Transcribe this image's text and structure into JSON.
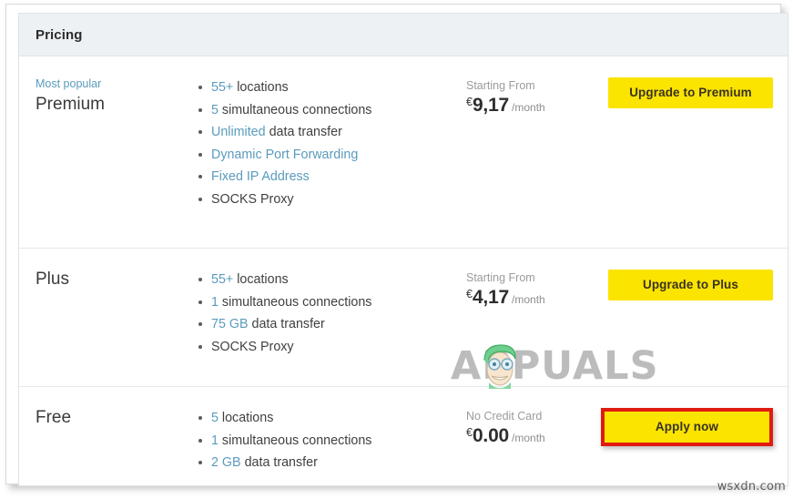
{
  "panel": {
    "title": "Pricing"
  },
  "plans": [
    {
      "badge": "Most popular",
      "name": "Premium",
      "features": [
        {
          "highlight": "55+",
          "rest": " locations"
        },
        {
          "highlight": "5",
          "rest": " simultaneous connections"
        },
        {
          "highlight": "Unlimited",
          "rest": " data transfer"
        },
        {
          "highlight": "Dynamic Port Forwarding",
          "rest": ""
        },
        {
          "highlight": "Fixed IP Address",
          "rest": ""
        },
        {
          "highlight": "",
          "rest": "SOCKS Proxy"
        }
      ],
      "price_label": "Starting From",
      "currency": "€",
      "amount": "9,17",
      "period": "/month",
      "cta": "Upgrade to Premium",
      "cta_highlighted": false
    },
    {
      "badge": "",
      "name": "Plus",
      "features": [
        {
          "highlight": "55+",
          "rest": " locations"
        },
        {
          "highlight": "1",
          "rest": " simultaneous connections"
        },
        {
          "highlight": "75 GB",
          "rest": " data transfer"
        },
        {
          "highlight": "",
          "rest": "SOCKS Proxy"
        }
      ],
      "price_label": "Starting From",
      "currency": "€",
      "amount": "4,17",
      "period": "/month",
      "cta": "Upgrade to Plus",
      "cta_highlighted": false
    },
    {
      "badge": "",
      "name": "Free",
      "features": [
        {
          "highlight": "5",
          "rest": " locations"
        },
        {
          "highlight": "1",
          "rest": " simultaneous connections"
        },
        {
          "highlight": "2 GB",
          "rest": " data transfer"
        }
      ],
      "price_label": "No Credit Card",
      "currency": "€",
      "amount": "0.00",
      "period": "/month",
      "cta": "Apply now",
      "cta_highlighted": true
    }
  ],
  "watermark": {
    "text": "APPUALS",
    "site_tag": "wsxdn.com"
  },
  "colors": {
    "accent_blue": "#5b9bbd",
    "button_yellow": "#fbe400",
    "highlight_red": "#e01b10",
    "header_bg": "#eef1f4"
  }
}
